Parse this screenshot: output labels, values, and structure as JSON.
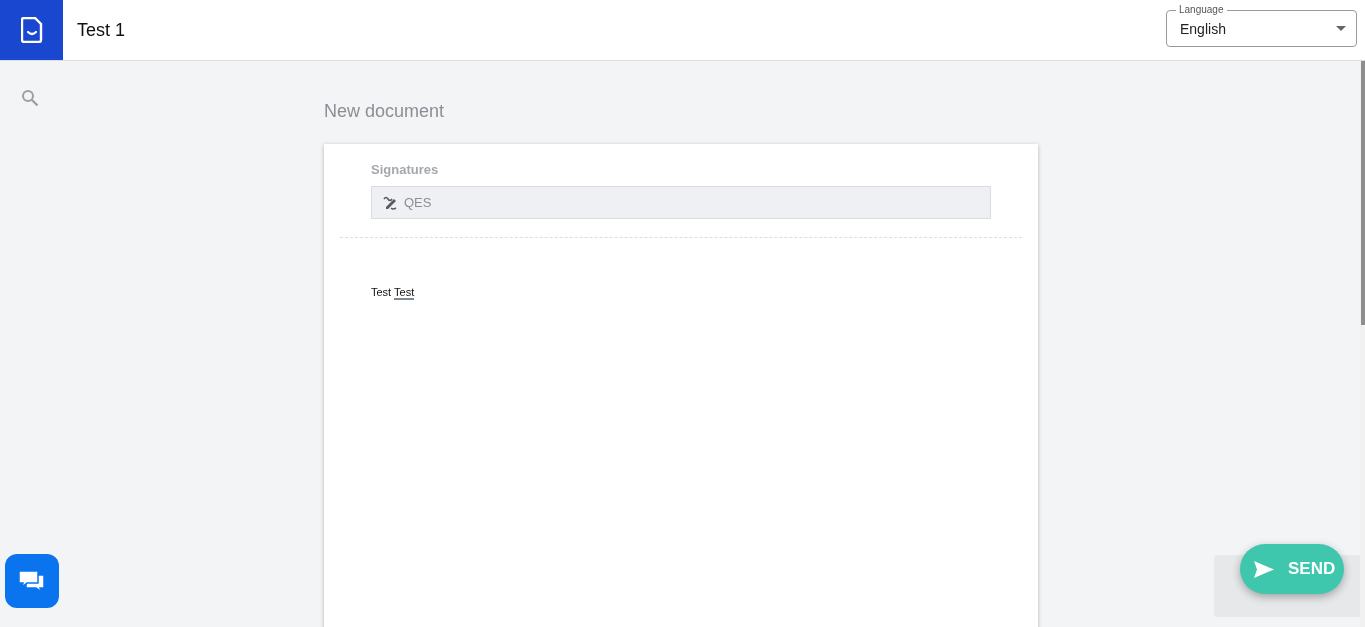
{
  "header": {
    "title": "Test 1",
    "language": {
      "label": "Language",
      "value": "English"
    }
  },
  "page": {
    "title": "New document"
  },
  "document": {
    "signatures_label": "Signatures",
    "signatures": [
      {
        "name": "QES"
      }
    ],
    "body": [
      {
        "text": "Test",
        "underlined": false
      },
      {
        "text": "Test",
        "underlined": true
      }
    ]
  },
  "send_button": {
    "label": "SEND"
  }
}
